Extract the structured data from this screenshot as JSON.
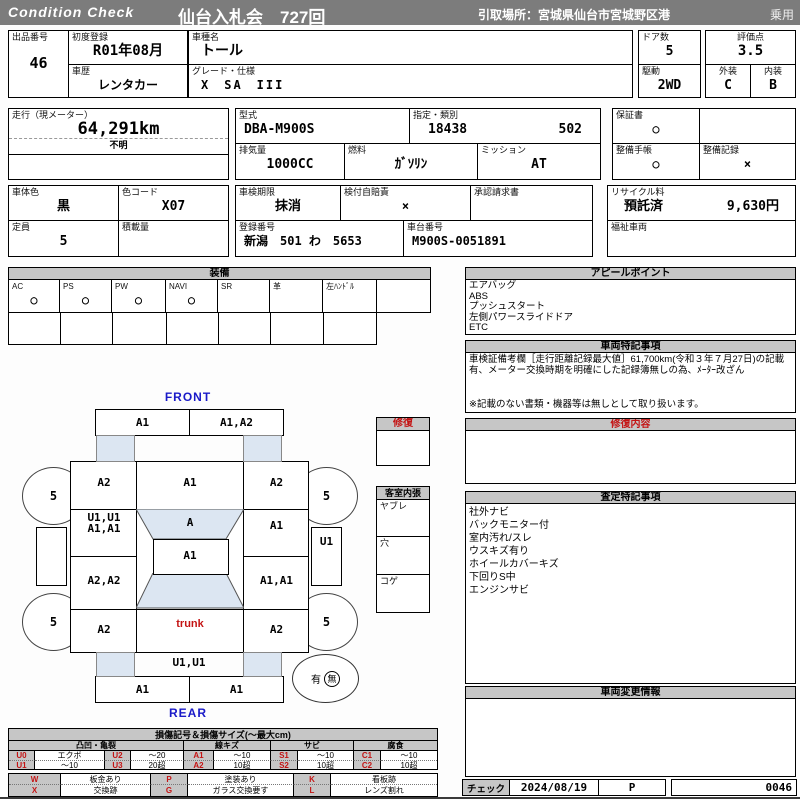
{
  "header": {
    "brand": "Condition  Check",
    "title": "仙台入札会　727回",
    "pickup": "引取場所：宮城県仙台市宮城野区港",
    "category": "乗用"
  },
  "fields": {
    "lot": {
      "label": "出品番号",
      "value": "46"
    },
    "first_reg": {
      "label": "初度登録",
      "value": "R01年08月"
    },
    "history": {
      "label": "車歴",
      "value": "レンタカー"
    },
    "model_name": {
      "label": "車種名",
      "value": "トール"
    },
    "grade": {
      "label": "グレード・仕様",
      "value": "X　SA　III"
    },
    "doors": {
      "label": "ドア数",
      "value": "5"
    },
    "score": {
      "label": "評価点",
      "value": "3.5"
    },
    "drive": {
      "label": "駆動",
      "value": "2WD"
    },
    "exterior": {
      "label": "外装",
      "value": "C"
    },
    "interior": {
      "label": "内装",
      "value": "B"
    },
    "mileage": {
      "label": "走行（現メーター）",
      "value": "64,291km",
      "note": "不明"
    },
    "model_code": {
      "label": "型式",
      "value": "DBA-M900S"
    },
    "class_no": {
      "label": "指定・類別",
      "value1": "18438",
      "value2": "502"
    },
    "displacement": {
      "label": "排気量",
      "value": "1000CC"
    },
    "fuel": {
      "label": "燃料",
      "value": "ｶﾞｿﾘﾝ"
    },
    "mission": {
      "label": "ミッション",
      "value": "AT"
    },
    "warranty": {
      "label": "保証書",
      "value": "○"
    },
    "maintenance_book": {
      "label": "整備手帳",
      "value": "○"
    },
    "maintenance_record": {
      "label": "整備記録",
      "value": "×"
    },
    "body_color": {
      "label": "車体色",
      "value": "黒"
    },
    "color_code": {
      "label": "色コード",
      "value": "X07"
    },
    "capacity": {
      "label": "定員",
      "value": "5"
    },
    "load": {
      "label": "積載量"
    },
    "inspection": {
      "label": "車検期限",
      "value": "抹消"
    },
    "insurance": {
      "label": "検付自賠責",
      "value": "×"
    },
    "approval": {
      "label": "承認請求書"
    },
    "reg_no": {
      "label": "登録番号",
      "value": "新潟　501 わ　5653"
    },
    "chassis": {
      "label": "車台番号",
      "value": "M900S-0051891"
    },
    "recycle": {
      "label": "リサイクル料",
      "status": "預託済",
      "fee": "9,630円"
    },
    "welfare": {
      "label": "福祉車両"
    }
  },
  "equipment": {
    "title": "装備",
    "items": [
      {
        "label": "AC",
        "value": "○"
      },
      {
        "label": "PS",
        "value": "○"
      },
      {
        "label": "PW",
        "value": "○"
      },
      {
        "label": "NAVI",
        "value": "○"
      },
      {
        "label": "SR",
        "value": ""
      },
      {
        "label": "革",
        "value": ""
      },
      {
        "label": "左ﾊﾝﾄﾞﾙ",
        "value": ""
      }
    ]
  },
  "appeal": {
    "title": "アピールポイント",
    "lines": [
      "エアバッグ",
      "ABS",
      "プッシュスタート",
      "左側パワースライドドア",
      "ETC"
    ]
  },
  "notes": {
    "title": "車両特記事項",
    "body": "車検証備考欄［走行距離記録最大値］61,700km(令和３年７月27日)の記載有、メーター交換時期を明確にした記録簿無しの為、ﾒｰﾀｰ改ざん",
    "footer": "※記載のない書類・機器等は無しとして取り扱います。"
  },
  "repair_box": {
    "title": "修復"
  },
  "cabin": {
    "title": "客室内張",
    "rows": [
      "ヤブレ",
      "穴",
      "コゲ"
    ]
  },
  "repair_content": {
    "title": "修復内容"
  },
  "assessment": {
    "title": "査定特記事項",
    "lines": [
      "社外ナビ",
      "バックモニター付",
      "室内汚れ/スレ",
      "ウスキズ有り",
      "ホイールカバーキズ",
      "下回りS中",
      "エンジンサビ"
    ]
  },
  "change_info": {
    "title": "車両変更情報"
  },
  "check": {
    "label": "チェック",
    "date": "2024/08/19",
    "code": "P",
    "number": "0046"
  },
  "diagram": {
    "front_label": "FRONT",
    "rear_label": "REAR",
    "wheel_mark": "5",
    "front_bumper_left": "A1",
    "front_bumper_right": "A1,A2",
    "left_front_fender": "A2",
    "hood": "A1",
    "right_front_fender": "A2",
    "windshield": "A",
    "left_front_door_line1": "U1,U1",
    "left_front_door_line2": "A1,A1",
    "right_front_door": "A1",
    "roof": "A1",
    "left_rear_door": "A2,A2",
    "right_rear_door": "A1,A1",
    "right_side_sill": "U1",
    "left_rear_fender": "A2",
    "trunk": "trunk",
    "right_rear_fender": "A2",
    "rear_panel": "U1,U1",
    "rear_bumper_left": "A1",
    "rear_bumper_right": "A1",
    "spare_yes": "有",
    "spare_no": "無"
  },
  "legend": {
    "title": "損傷記号＆損傷サイズ(～最大cm)",
    "groups": [
      "凸凹・亀裂",
      "線キズ",
      "サビ",
      "腐食"
    ],
    "row1": [
      "U0",
      "エクボ",
      "U2",
      "～20",
      "A1",
      "～10",
      "S1",
      "～10",
      "C1",
      "～10"
    ],
    "row2": [
      "U1",
      "～10",
      "U3",
      "20超",
      "A2",
      "10超",
      "S2",
      "10超",
      "C2",
      "10超"
    ],
    "codes_row1": [
      "W",
      "板金あり",
      "P",
      "塗装あり",
      "K",
      "看板跡"
    ],
    "codes_row2": [
      "X",
      "交換跡",
      "G",
      "ガラス交換要す",
      "L",
      "レンズ割れ"
    ]
  }
}
